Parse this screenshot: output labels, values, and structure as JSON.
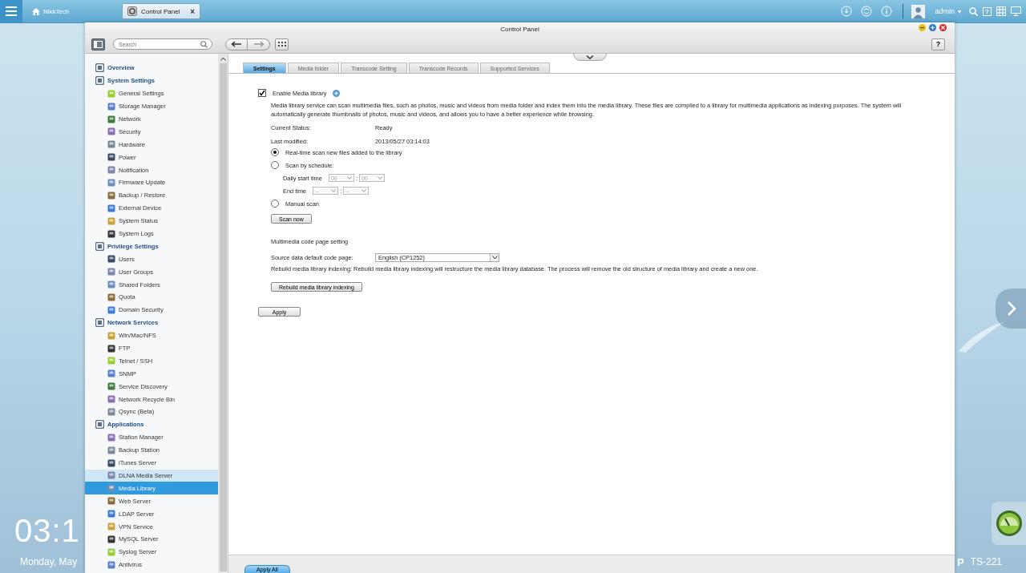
{
  "topbar": {
    "home_tab": "NikkTech",
    "app_tab": "Control Panel",
    "app_tab_close": "×",
    "user": "admin",
    "user_caret": "▾",
    "help": "?"
  },
  "desktop": {
    "clock": "03:1",
    "date": "Monday, May",
    "model_logo": "P",
    "model": "TS-221"
  },
  "window": {
    "title": "Control Panel",
    "search_placeholder": "Search",
    "help": "?"
  },
  "sidebar": [
    {
      "label": "Overview",
      "selected": false
    },
    {
      "label": "System Settings",
      "selected": false,
      "children": [
        {
          "label": "General Settings",
          "selected": false,
          "hovered": false
        },
        {
          "label": "Storage Manager",
          "selected": false,
          "hovered": false
        },
        {
          "label": "Network",
          "selected": false,
          "hovered": false
        },
        {
          "label": "Security",
          "selected": false,
          "hovered": false
        },
        {
          "label": "Hardware",
          "selected": false,
          "hovered": false
        },
        {
          "label": "Power",
          "selected": false,
          "hovered": false
        },
        {
          "label": "Notification",
          "selected": false,
          "hovered": false
        },
        {
          "label": "Firmware Update",
          "selected": false,
          "hovered": false
        },
        {
          "label": "Backup / Restore",
          "selected": false,
          "hovered": false
        },
        {
          "label": "External Device",
          "selected": false,
          "hovered": false
        },
        {
          "label": "System Status",
          "selected": false,
          "hovered": false
        },
        {
          "label": "System Logs",
          "selected": false,
          "hovered": false
        }
      ]
    },
    {
      "label": "Privilege Settings",
      "selected": false,
      "children": [
        {
          "label": "Users",
          "selected": false,
          "hovered": false
        },
        {
          "label": "User Groups",
          "selected": false,
          "hovered": false
        },
        {
          "label": "Shared Folders",
          "selected": false,
          "hovered": false
        },
        {
          "label": "Quota",
          "selected": false,
          "hovered": false
        },
        {
          "label": "Domain Security",
          "selected": false,
          "hovered": false
        }
      ]
    },
    {
      "label": "Network Services",
      "selected": false,
      "children": [
        {
          "label": "Win/Mac/NFS",
          "selected": false,
          "hovered": false
        },
        {
          "label": "FTP",
          "selected": false,
          "hovered": false
        },
        {
          "label": "Telnet / SSH",
          "selected": false,
          "hovered": false
        },
        {
          "label": "SNMP",
          "selected": false,
          "hovered": false
        },
        {
          "label": "Service Discovery",
          "selected": false,
          "hovered": false
        },
        {
          "label": "Network Recycle Bin",
          "selected": false,
          "hovered": false
        },
        {
          "label": "Qsync (Beta)",
          "selected": false,
          "hovered": false
        }
      ]
    },
    {
      "label": "Applications",
      "selected": false,
      "children": [
        {
          "label": "Station Manager",
          "selected": false,
          "hovered": false
        },
        {
          "label": "Backup Station",
          "selected": false,
          "hovered": false
        },
        {
          "label": "iTunes Server",
          "selected": false,
          "hovered": false
        },
        {
          "label": "DLNA Media Server",
          "selected": false,
          "hovered": true
        },
        {
          "label": "Media Library",
          "selected": true,
          "hovered": false
        },
        {
          "label": "Web Server",
          "selected": false,
          "hovered": false
        },
        {
          "label": "LDAP Server",
          "selected": false,
          "hovered": false
        },
        {
          "label": "VPN Service",
          "selected": false,
          "hovered": false
        },
        {
          "label": "MySQL Server",
          "selected": false,
          "hovered": false
        },
        {
          "label": "Syslog Server",
          "selected": false,
          "hovered": false
        },
        {
          "label": "Antivirus",
          "selected": false,
          "hovered": false
        }
      ]
    }
  ],
  "tabs": [
    {
      "label": "Settings",
      "selected": true
    },
    {
      "label": "Media folder",
      "selected": false
    },
    {
      "label": "Transcode Setting",
      "selected": false
    },
    {
      "label": "Transcode Records",
      "selected": false
    },
    {
      "label": "Supported Services",
      "selected": false
    }
  ],
  "content": {
    "enable": {
      "label": "Enable Media library",
      "checked": true
    },
    "description": "Media library service can scan multimedia files, such as photos, music and videos from media folder and index them into the media library. These files are compiled to a library for multimedia applications as indexing purposes. The system will automatically generate thumbnails of photos, music and videos, and allows you to have a better experience while browsing.",
    "status": [
      {
        "label": "Current Status:",
        "value": "Ready"
      },
      {
        "label": "Last modified:",
        "value": "2013/05/27 03:14:03"
      }
    ],
    "scan_options": [
      {
        "label": "Real-time scan new files added to the library",
        "selected": true
      },
      {
        "label": "Scan by schedule:",
        "selected": false,
        "schedule": [
          {
            "label": "Daily start time",
            "hour": "00",
            "separator": ":",
            "minute": "00",
            "disabled": true
          },
          {
            "label": "End time",
            "hour": "--",
            "separator": ":",
            "minute": "--",
            "disabled": true
          }
        ]
      },
      {
        "label": "Manual scan",
        "selected": false
      }
    ],
    "scan_button": "Scan now",
    "codepage_title": "Multimedia code page setting",
    "codepage_label": "Source data default code page:",
    "codepage_value": "English (CP1252)",
    "rebuild_note": "Rebuild media library indexing: Rebuild media library indexing will restructure the media library database. The process will remove the old structure of media library and create a new one.",
    "rebuild_button": "Rebuild media library indexing",
    "apply": "Apply"
  },
  "footer": {
    "apply_all": "Apply All"
  }
}
